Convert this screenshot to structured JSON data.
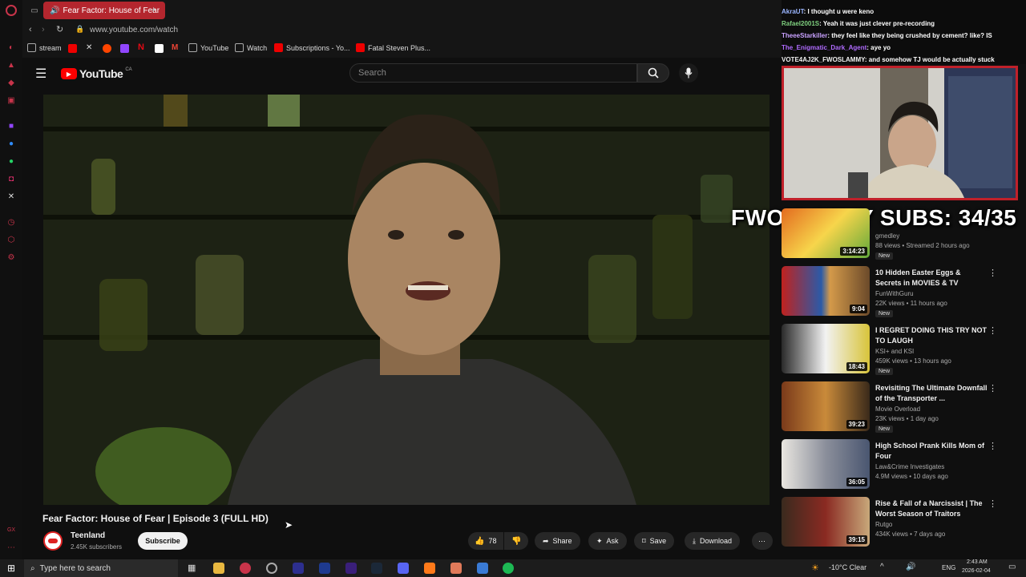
{
  "browser": {
    "tab_title": "Fear Factor: House of Fear",
    "url": "www.youtube.com/watch",
    "bookmarks": [
      "stream",
      "YouTube",
      "Watch",
      "Subscriptions - Yo...",
      "Fatal Steven Plus..."
    ]
  },
  "youtube": {
    "logo": "YouTube",
    "region": "CA",
    "search_placeholder": "Search"
  },
  "video": {
    "title": "Fear Factor: House of Fear | Episode 3 (FULL HD)",
    "channel": "Teenland",
    "subscribers": "2.45K subscribers",
    "subscribe_label": "Subscribe",
    "likes": "78",
    "share_label": "Share",
    "ask_label": "Ask",
    "save_label": "Save",
    "download_label": "Download"
  },
  "chat": [
    {
      "user": "AkraUT",
      "text": ": I thought u were keno",
      "color": "#9ab5ff"
    },
    {
      "user": "Rafael2001S",
      "text": ": Yeah it was just clever pre-recording",
      "color": "#7fd07f"
    },
    {
      "user": "TheeeStarkiller",
      "text": ": they feel like they being crushed by cement? like? IS",
      "color": "#c9a2ff"
    },
    {
      "user": "The_Enigmatic_Dark_Agent",
      "text": ": aye yo",
      "color": "#b06bff"
    },
    {
      "user": "VOTE4AJ2K_FWOSLAMMY",
      "text": ": and somehow TJ would be actually stuck",
      "color": "#f0f0f0"
    }
  ],
  "overlay_text": "FWO'S SEXY SUBS: 34/35",
  "recommendations": [
    {
      "title": "",
      "channel": "gmedley",
      "meta": "88 views • Streamed 2 hours ago",
      "duration": "3:14:23",
      "badge": "New"
    },
    {
      "title": "10 Hidden Easter Eggs & Secrets in MOVIES & TV",
      "channel": "FunWithGuru",
      "meta": "22K views • 11 hours ago",
      "duration": "9:04",
      "badge": "New"
    },
    {
      "title": "I REGRET DOING THIS TRY NOT TO LAUGH",
      "channel": "KSI+ and KSI",
      "meta": "459K views • 13 hours ago",
      "duration": "18:43",
      "badge": "New"
    },
    {
      "title": "Revisiting The Ultimate Downfall of the Transporter ...",
      "channel": "Movie Overload",
      "meta": "23K views • 1 day ago",
      "duration": "39:23",
      "badge": "New"
    },
    {
      "title": "High School Prank Kills Mom of Four",
      "channel": "Law&Crime Investigates",
      "meta": "4.9M views • 10 days ago",
      "duration": "36:05",
      "badge": ""
    },
    {
      "title": "Rise & Fall of a Narcissist | The Worst Season of Traitors",
      "channel": "Rutgo",
      "meta": "434K views • 7 days ago",
      "duration": "39:15",
      "badge": ""
    }
  ],
  "taskbar": {
    "search_placeholder": "Type here to search",
    "weather": "-10°C  Clear",
    "lang": "ENG",
    "time": "2:43 AM",
    "date": "2026-02-04"
  },
  "colors": {
    "accent": "#ff0000",
    "stream_red": "#c0202a"
  }
}
